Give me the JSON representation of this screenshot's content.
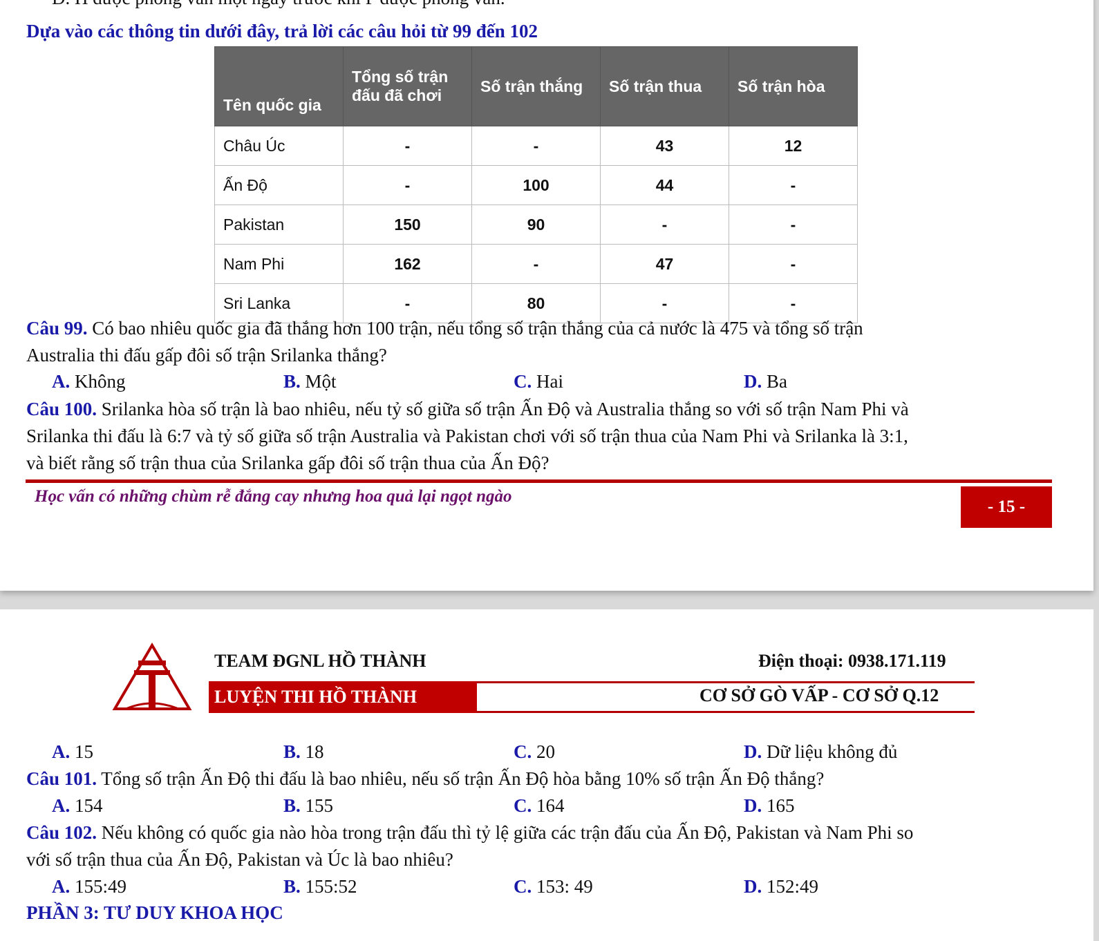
{
  "top_cut_text": "D. H được phỏng vấn một ngày trước khi P được phỏng vấn.",
  "intro": "Dựa vào các thông tin dưới đây, trả lời các câu hỏi từ 99 đến 102",
  "table": {
    "headers": [
      "Tên quốc gia",
      "Tổng số trận đấu đã chơi",
      "Số trận thắng",
      "Số trận thua",
      "Số trận hòa"
    ],
    "rows": [
      [
        "Châu Úc",
        "-",
        "-",
        "43",
        "12"
      ],
      [
        "Ấn Độ",
        "-",
        "100",
        "44",
        "-"
      ],
      [
        "Pakistan",
        "150",
        "90",
        "-",
        "-"
      ],
      [
        "Nam Phi",
        "162",
        "-",
        "47",
        "-"
      ],
      [
        "Sri Lanka",
        "-",
        "80",
        "-",
        "-"
      ]
    ]
  },
  "q99": {
    "label": "Câu 99.",
    "line1": " Có bao nhiêu quốc gia đã thắng hơn 100 trận, nếu tổng số trận thắng của cả nước là 475 và tổng số trận",
    "line2": "Australia thi đấu gấp đôi số trận Srilanka thắng?",
    "options": [
      [
        "A.",
        " Không"
      ],
      [
        "B.",
        " Một"
      ],
      [
        "C.",
        " Hai"
      ],
      [
        "D.",
        " Ba"
      ]
    ]
  },
  "q100": {
    "label": "Câu 100.",
    "line1": " Srilanka hòa số trận là bao nhiêu, nếu tỷ số giữa số trận Ấn Độ và Australia thắng so với số trận Nam Phi và",
    "line2": "Srilanka thi đấu là 6:7 và tỷ số giữa số trận Australia và Pakistan chơi với số trận thua của Nam Phi và Srilanka là 3:1,",
    "line3": "và biết rằng số trận thua của Srilanka gấp đôi số trận thua của Ấn Độ?",
    "options": [
      [
        "A.",
        " 15"
      ],
      [
        "B.",
        " 18"
      ],
      [
        "C.",
        " 20"
      ],
      [
        "D.",
        " Dữ liệu không đủ"
      ]
    ]
  },
  "footer": {
    "motto": "Học vấn có những chùm rễ đắng cay nhưng hoa quả lại ngọt ngào",
    "page": "- 15 -"
  },
  "header": {
    "team": "TEAM ĐGNL HỒ THÀNH",
    "phone": "Điện thoại: 0938.171.119",
    "brand": "LUYỆN THI HỒ THÀNH",
    "branches": "CƠ SỞ GÒ VẤP - CƠ SỞ Q.12",
    "logo_color": "#b30000"
  },
  "q101": {
    "label": "Câu 101.",
    "line1": " Tổng số trận Ấn Độ thi đấu là bao nhiêu, nếu số trận Ấn Độ hòa bằng 10% số trận Ấn Độ thắng?",
    "options": [
      [
        "A.",
        " 154"
      ],
      [
        "B.",
        " 155"
      ],
      [
        "C.",
        " 164"
      ],
      [
        "D.",
        " 165"
      ]
    ]
  },
  "q102": {
    "label": "Câu 102.",
    "line1": " Nếu không có quốc gia nào hòa trong trận đấu thì tỷ lệ giữa các trận đấu của Ấn Độ, Pakistan và Nam Phi so",
    "line2": "với số trận thua của Ấn Độ, Pakistan và Úc là bao nhiêu?",
    "options": [
      [
        "A.",
        " 155:49"
      ],
      [
        "B.",
        " 155:52"
      ],
      [
        "C.",
        " 153: 49"
      ],
      [
        "D.",
        " 152:49"
      ]
    ]
  },
  "section": "PHẦN 3: TƯ DUY KHOA HỌC"
}
